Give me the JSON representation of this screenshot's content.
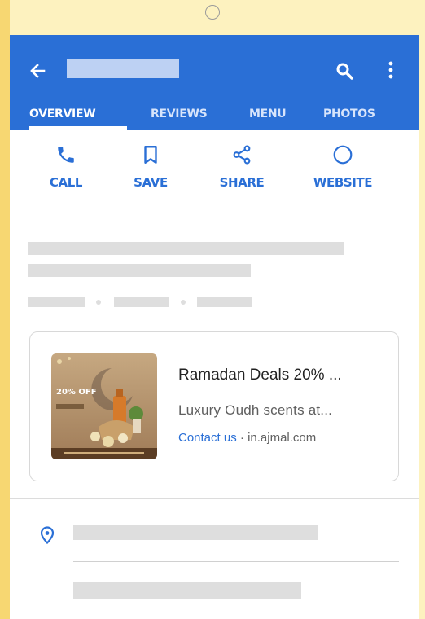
{
  "toolbar": {
    "back_icon": "back-arrow-icon",
    "search_icon": "search-icon",
    "more_icon": "more-vertical-icon",
    "color": "#2a6fd6"
  },
  "tabs": [
    {
      "label": "OVERVIEW",
      "active": true
    },
    {
      "label": "REVIEWS",
      "active": false
    },
    {
      "label": "MENU",
      "active": false
    },
    {
      "label": "PHOTOS",
      "active": false
    }
  ],
  "actions": [
    {
      "label": "CALL",
      "icon": "phone-icon"
    },
    {
      "label": "SAVE",
      "icon": "bookmark-icon"
    },
    {
      "label": "SHARE",
      "icon": "share-icon"
    },
    {
      "label": "WEBSITE",
      "icon": "globe-icon"
    }
  ],
  "ad": {
    "title": "Ramadan Deals 20% ...",
    "description": "Luxury Oudh scents at...",
    "cta": "Contact us",
    "separator": " · ",
    "domain": "in.ajmal.com",
    "image": {
      "badge": "20% OFF"
    }
  },
  "location": {
    "icon": "location-pin-icon"
  }
}
